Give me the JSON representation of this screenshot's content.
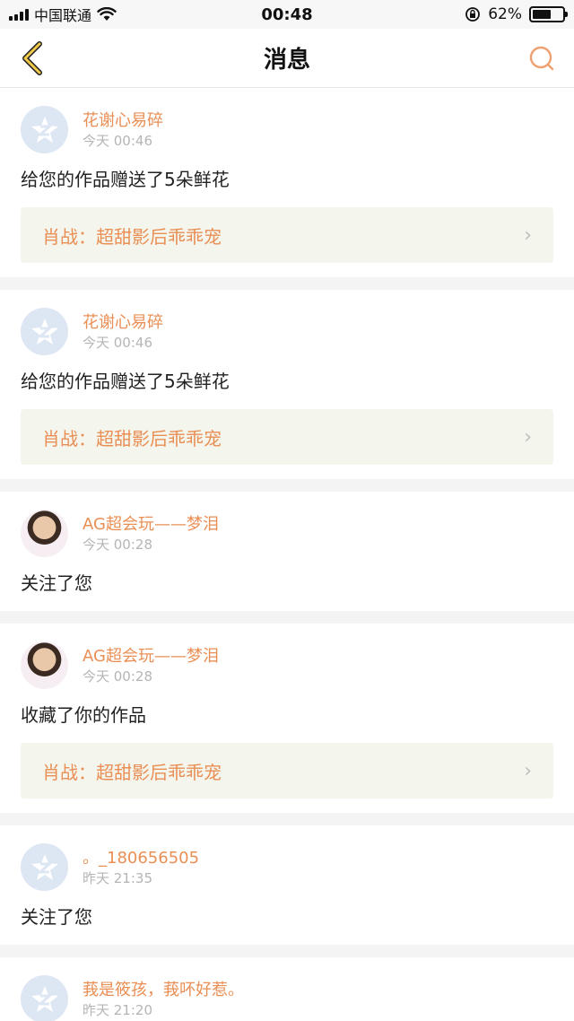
{
  "status": {
    "carrier": "中国联通",
    "time": "00:48",
    "battery": "62%"
  },
  "nav": {
    "title": "消息"
  },
  "messages": [
    {
      "name": "花谢心易碎",
      "time": "今天 00:46",
      "text": "给您的作品赠送了5朵鲜花",
      "link": "肖战：超甜影后乖乖宠",
      "avatar": "default-avatar-icon"
    },
    {
      "name": "花谢心易碎",
      "time": "今天 00:46",
      "text": "给您的作品赠送了5朵鲜花",
      "link": "肖战：超甜影后乖乖宠",
      "avatar": "default-avatar-icon"
    },
    {
      "name": "AG超会玩——梦泪",
      "time": "今天 00:28",
      "text": "关注了您",
      "avatar": "photo"
    },
    {
      "name": "AG超会玩——梦泪",
      "time": "今天 00:28",
      "text": "收藏了你的作品",
      "link": "肖战：超甜影后乖乖宠",
      "avatar": "photo"
    },
    {
      "name": "。_180656505",
      "time": "昨天 21:35",
      "text": "关注了您",
      "avatar": "default-avatar-icon"
    },
    {
      "name": "莪是筱孩，莪吥好惹。",
      "time": "昨天 21:20",
      "avatar": "default-avatar-icon"
    }
  ],
  "colors": {
    "accent": "#e98f55",
    "link_bg": "#f4f5ec"
  }
}
